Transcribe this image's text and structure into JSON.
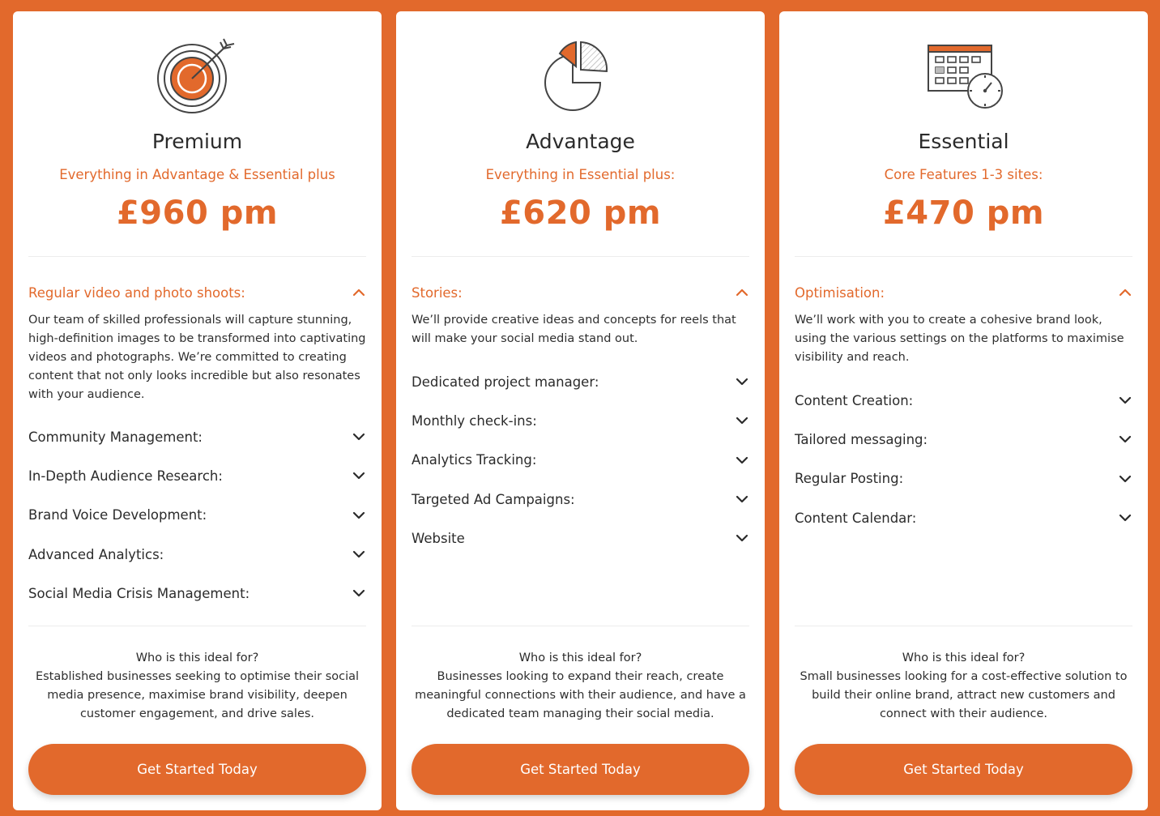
{
  "colors": {
    "accent": "#e2692c",
    "text": "#2b2b2b",
    "card": "#ffffff"
  },
  "plans": [
    {
      "icon": "target-icon",
      "title": "Premium",
      "subtitle": "Everything in Advantage & Essential plus",
      "price": "£960 pm",
      "open_section": {
        "title": "Regular video and photo shoots:",
        "body": "Our team of skilled professionals will capture stunning, high-definition images to be transformed into captivating videos and photographs. We’re committed to creating content that not only looks incredible but also resonates with your audience."
      },
      "sections": [
        "Community Management:",
        "In-Depth Audience Research:",
        "Brand Voice Development:",
        "Advanced Analytics:",
        "Social Media Crisis Management:"
      ],
      "ideal_question": "Who is this ideal for?",
      "ideal_text": "Established businesses seeking to optimise their social media presence, maximise brand visibility, deepen customer engagement, and drive sales.",
      "cta": "Get Started Today"
    },
    {
      "icon": "pie-chart-icon",
      "title": "Advantage",
      "subtitle": "Everything in Essential plus:",
      "price": "£620 pm",
      "open_section": {
        "title": "Stories:",
        "body": "We’ll provide creative ideas and concepts for reels that will make your social media stand out."
      },
      "sections": [
        "Dedicated project manager:",
        "Monthly check-ins:",
        "Analytics Tracking:",
        "Targeted Ad Campaigns:",
        "Website"
      ],
      "ideal_question": "Who is this ideal for?",
      "ideal_text": "Businesses looking to expand their reach, create meaningful connections with their audience, and have a dedicated team managing their social media.",
      "cta": "Get Started Today"
    },
    {
      "icon": "calendar-clock-icon",
      "title": "Essential",
      "subtitle": "Core Features 1-3 sites:",
      "price": "£470 pm",
      "open_section": {
        "title": "Optimisation:",
        "body": "We’ll work with you to create a cohesive brand look, using the various settings on the platforms to maximise visibility and reach."
      },
      "sections": [
        "Content Creation:",
        "Tailored messaging:",
        "Regular Posting:",
        "Content Calendar:"
      ],
      "ideal_question": "Who is this ideal for?",
      "ideal_text": "Small businesses looking for a cost-effective solution to build their online brand, attract new customers and connect with their audience.",
      "cta": "Get Started Today"
    }
  ]
}
